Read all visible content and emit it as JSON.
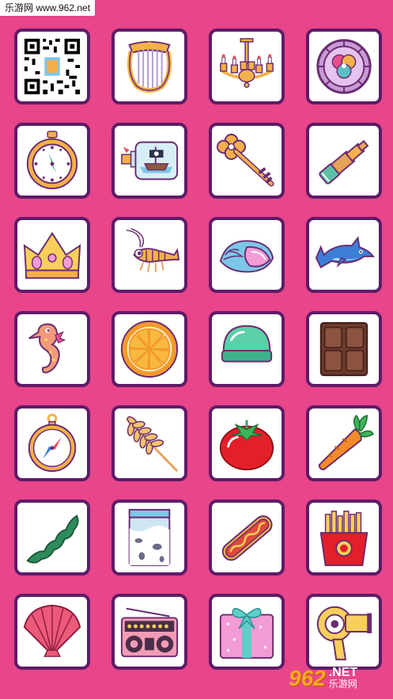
{
  "watermark_top": "乐游网 www.962.net",
  "watermark_bottom": {
    "number": "962",
    "net": ".NET",
    "cn": "乐游网"
  },
  "colors": {
    "background": "#e8458b",
    "tile_border": "#5e1c66",
    "tile_fill": "#ffffff"
  },
  "grid": [
    [
      "qr-code",
      "harp",
      "chandelier",
      "stained-glass-window"
    ],
    [
      "pocket-watch",
      "ship-in-bottle",
      "key",
      "spyglass"
    ],
    [
      "crown",
      "shrimp",
      "seashell",
      "dolphin"
    ],
    [
      "seahorse",
      "orange-slice",
      "bath-bomb",
      "chocolate-bar"
    ],
    [
      "compass",
      "wheat",
      "tomato",
      "carrot"
    ],
    [
      "seaweed",
      "milk-carton",
      "hot-dog",
      "french-fries"
    ],
    [
      "scallop-shell",
      "radio",
      "gift-box",
      "hair-dryer"
    ]
  ]
}
